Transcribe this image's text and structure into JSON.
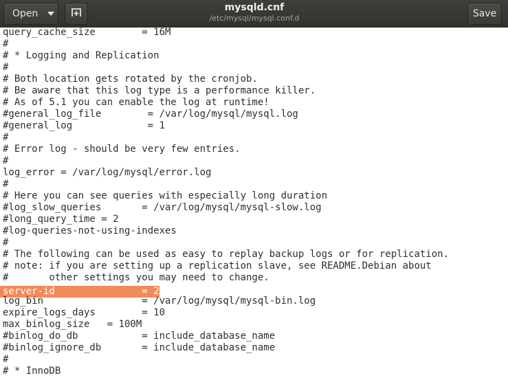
{
  "header": {
    "open_label": "Open",
    "title": "mysqld.cnf",
    "subtitle": "/etc/mysql/mysql.conf.d",
    "save_label": "Save"
  },
  "colors": {
    "headerbar": "#3c3b37",
    "selection": "#f18a59",
    "text": "#2e2e2e"
  },
  "editor": {
    "selected_line_index": 22,
    "lines": [
      "query_cache_size        = 16M",
      "#",
      "# * Logging and Replication",
      "#",
      "# Both location gets rotated by the cronjob.",
      "# Be aware that this log type is a performance killer.",
      "# As of 5.1 you can enable the log at runtime!",
      "#general_log_file        = /var/log/mysql/mysql.log",
      "#general_log             = 1",
      "#",
      "# Error log - should be very few entries.",
      "#",
      "log_error = /var/log/mysql/error.log",
      "#",
      "# Here you can see queries with especially long duration",
      "#log_slow_queries       = /var/log/mysql/mysql-slow.log",
      "#long_query_time = 2",
      "#log-queries-not-using-indexes",
      "#",
      "# The following can be used as easy to replay backup logs or for replication.",
      "# note: if you are setting up a replication slave, see README.Debian about",
      "#       other settings you may need to change.",
      "server-id               = 2",
      "log_bin                 = /var/log/mysql/mysql-bin.log",
      "expire_logs_days        = 10",
      "max_binlog_size   = 100M",
      "#binlog_do_db           = include_database_name",
      "#binlog_ignore_db       = include_database_name",
      "#",
      "# * InnoDB"
    ]
  }
}
